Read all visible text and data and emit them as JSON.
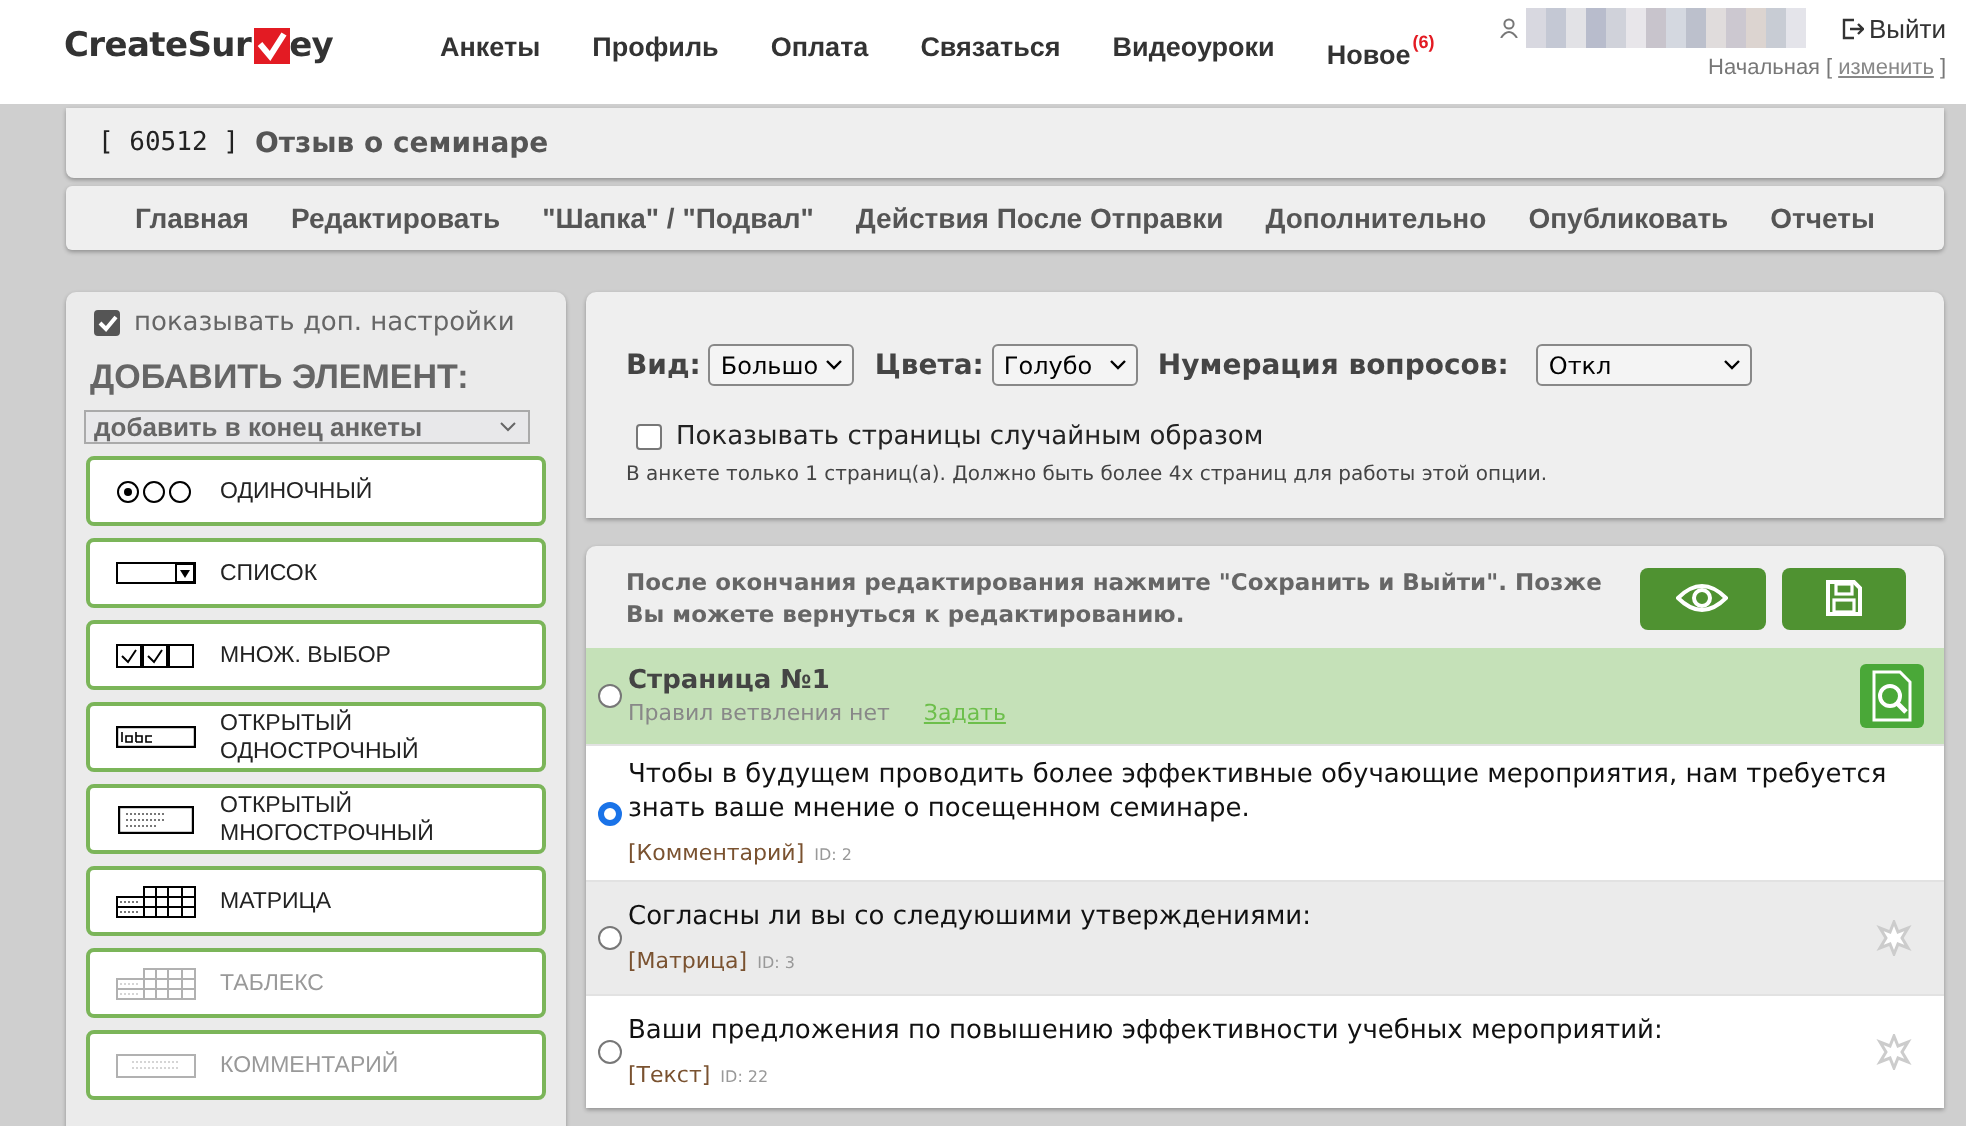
{
  "header": {
    "logo_left": "CreateSur",
    "logo_right": "ey",
    "menu": [
      {
        "label": "Анкеты"
      },
      {
        "label": "Профиль"
      },
      {
        "label": "Оплата"
      },
      {
        "label": "Связаться"
      },
      {
        "label": "Видеоуроки"
      },
      {
        "label": "Новое",
        "badge": "(6)"
      }
    ],
    "logout": "Выйти",
    "home": "Начальная",
    "change_open": "[",
    "change": "изменить",
    "change_close": "]"
  },
  "survey": {
    "id": "[ 60512 ]",
    "title": "Отзыв о семинаре"
  },
  "tabs": [
    {
      "label": "Главная"
    },
    {
      "label": "Редактировать"
    },
    {
      "label": "\"Шапка\" / \"Подвал\""
    },
    {
      "label": "Действия После Отправки"
    },
    {
      "label": "Дополнительно"
    },
    {
      "label": "Опубликовать"
    },
    {
      "label": "Отчеты"
    }
  ],
  "sidebar": {
    "show_extra": {
      "label": "показывать доп. настройки",
      "checked": true
    },
    "heading": "ДОБАВИТЬ ЭЛЕМЕНТ:",
    "position": "добавить в конец анкеты",
    "elements": [
      {
        "kind": "radio",
        "label": "ОДИНОЧНЫЙ",
        "disabled": false
      },
      {
        "kind": "list",
        "label": "СПИСОК",
        "disabled": false
      },
      {
        "kind": "multi",
        "label": "МНОЖ. ВЫБОР",
        "disabled": false
      },
      {
        "kind": "line",
        "label": "ОТКРЫТЫЙ ОДНОСТРОЧНЫЙ",
        "disabled": false
      },
      {
        "kind": "text",
        "label": "ОТКРЫТЫЙ МНОГОСТРОЧНЫЙ",
        "disabled": false
      },
      {
        "kind": "matrix",
        "label": "МАТРИЦА",
        "disabled": false
      },
      {
        "kind": "matrix",
        "label": "ТАБЛЕКС",
        "disabled": true
      },
      {
        "kind": "comment",
        "label": "КОММЕНТАРИЙ",
        "disabled": true
      }
    ]
  },
  "settings": {
    "fields": [
      {
        "label": "Вид:",
        "value": "Большо",
        "kind": "short"
      },
      {
        "label": "Цвета:",
        "value": "Голубо",
        "kind": "short"
      },
      {
        "label": "Нумерация вопросов:",
        "value": "Откл",
        "kind": "wide"
      }
    ],
    "random": {
      "label": "Показывать страницы случайным образом",
      "checked": false
    },
    "note": "В анкете только 1 страниц(а). Должно быть более 4х страниц для работы этой опции."
  },
  "editor": {
    "hint": "После окончания редактирования нажмите \"Сохранить и Выйти\". Позже Вы можете вернуться к редактированию.",
    "page": {
      "title": "Страница №1",
      "rules": "Правил ветвления нет",
      "rules_link": "Задать",
      "selected": false
    },
    "questions": [
      {
        "text": "Чтобы в будущем проводить более эффективные обучающие мероприятия, нам требуется знать ваше мнение о посещенном семинаре.",
        "type": "[Комментарий]",
        "id": "ID: 2",
        "selected": true
      },
      {
        "text": "Согласны ли вы со следуюшими утверждениями:",
        "type": "[Матрица]",
        "id": "ID: 3",
        "selected": false
      },
      {
        "text": "Ваши предложения по повышению эффективности учебных мероприятий:",
        "type": "[Текст]",
        "id": "ID: 22",
        "selected": false
      }
    ]
  }
}
